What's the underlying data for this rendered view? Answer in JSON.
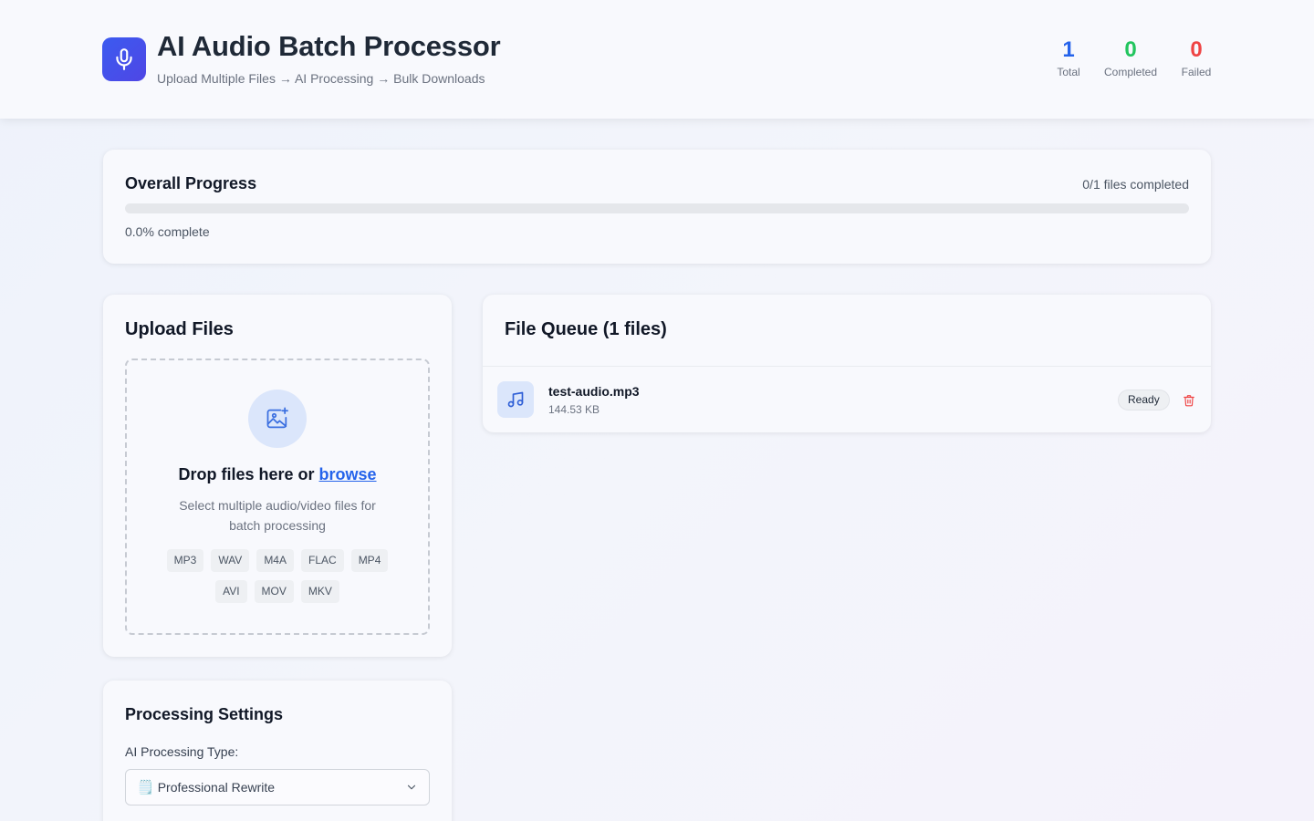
{
  "header": {
    "title": "AI Audio Batch Processor",
    "subtitle": "Upload Multiple Files → AI Processing → Bulk Downloads",
    "logo_icon": "microphone-icon",
    "stats": [
      {
        "value": "1",
        "label": "Total",
        "color": "#2563eb"
      },
      {
        "value": "0",
        "label": "Completed",
        "color": "#22c55e"
      },
      {
        "value": "0",
        "label": "Failed",
        "color": "#ef4444"
      }
    ]
  },
  "progress": {
    "title": "Overall Progress",
    "count_text": "0/1 files completed",
    "percent_text": "0.0% complete",
    "fraction": 0.0
  },
  "upload": {
    "title": "Upload Files",
    "icon": "image-plus-icon",
    "drop_text": "Drop files here or",
    "browse_link": "browse",
    "description": "Select multiple audio/video files for batch processing",
    "formats": [
      "MP3",
      "WAV",
      "M4A",
      "FLAC",
      "MP4",
      "AVI",
      "MOV",
      "MKV"
    ]
  },
  "settings": {
    "title": "Processing Settings",
    "type_label": "AI Processing Type:",
    "selected_type": "Professional Rewrite",
    "selected_icon": "🗒️"
  },
  "queue": {
    "title": "File Queue (1 files)",
    "files": [
      {
        "name": "test-audio.mp3",
        "size": "144.53 KB",
        "status": "Ready",
        "icon": "music-note-icon"
      }
    ]
  },
  "colors": {
    "accent": "#2563eb",
    "success": "#22c55e",
    "danger": "#ef4444"
  }
}
